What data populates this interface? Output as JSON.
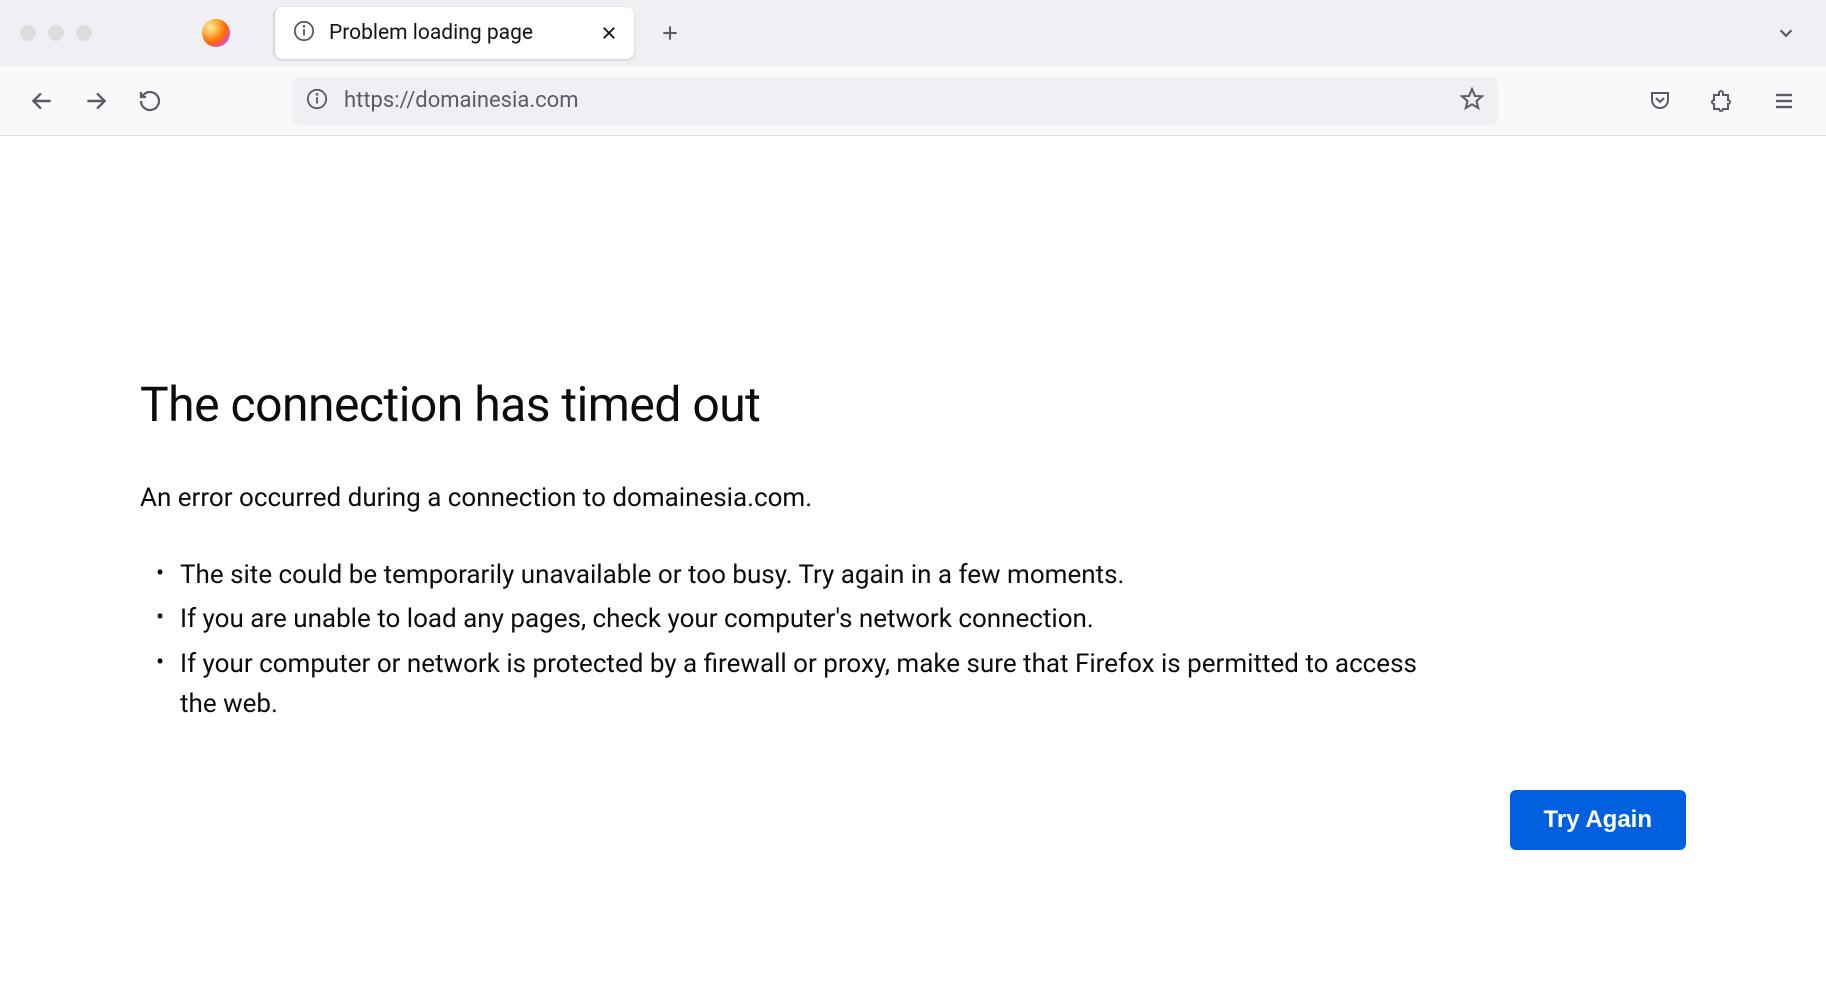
{
  "tab": {
    "title": "Problem loading page"
  },
  "urlbar": {
    "url": "https://domainesia.com"
  },
  "error": {
    "title": "The connection has timed out",
    "subtitle": "An error occurred during a connection to domainesia.com.",
    "bullets": [
      "The site could be temporarily unavailable or too busy. Try again in a few moments.",
      "If you are unable to load any pages, check your computer's network connection.",
      "If your computer or network is protected by a firewall or proxy, make sure that Firefox is permitted to access the web."
    ],
    "try_again_label": "Try Again"
  }
}
